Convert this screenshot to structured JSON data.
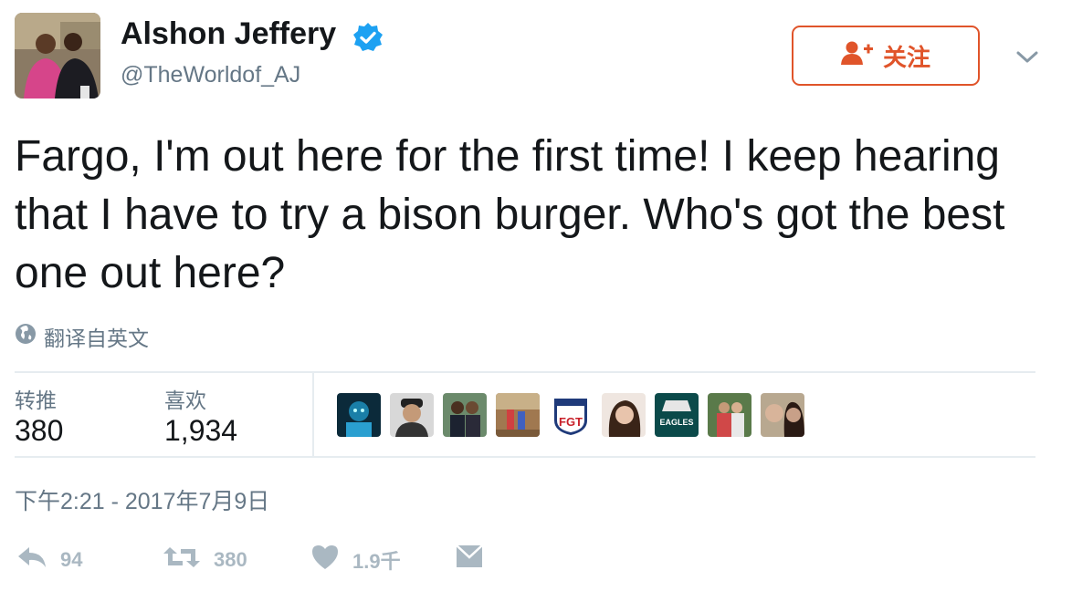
{
  "author": {
    "name": "Alshon Jeffery",
    "handle": "@TheWorldof_AJ",
    "avatar_icon": "profile-photo",
    "verified_icon": "verified-badge-icon"
  },
  "follow_button": {
    "label": "关注",
    "icon": "add-user-icon",
    "color": "#e0542a"
  },
  "tweet": {
    "text": "Fargo, I'm out here for the first time! I keep hearing that I have to try a bison burger. Who's got the best one out here?",
    "translate_label": "翻译自英文",
    "translate_icon": "globe-icon"
  },
  "stats": {
    "retweets_label": "转推",
    "retweets_value": "380",
    "likes_label": "喜欢",
    "likes_value": "1,934"
  },
  "likers": [
    {
      "name": "liker-avatar-1"
    },
    {
      "name": "liker-avatar-2"
    },
    {
      "name": "liker-avatar-3"
    },
    {
      "name": "liker-avatar-4"
    },
    {
      "name": "liker-avatar-5",
      "text": "FGT"
    },
    {
      "name": "liker-avatar-6"
    },
    {
      "name": "liker-avatar-7",
      "text": "EAGLES"
    },
    {
      "name": "liker-avatar-8"
    },
    {
      "name": "liker-avatar-9"
    }
  ],
  "timestamp": "下午2:21 - 2017年7月9日",
  "actions": {
    "reply_count": "94",
    "retweet_count": "380",
    "like_count": "1.9千",
    "reply_icon": "reply-icon",
    "retweet_icon": "retweet-icon",
    "like_icon": "heart-icon",
    "dm_icon": "envelope-icon"
  },
  "colors": {
    "accent": "#e0542a",
    "verified": "#1da1f2",
    "muted": "#657786",
    "action": "#aab8c2"
  }
}
